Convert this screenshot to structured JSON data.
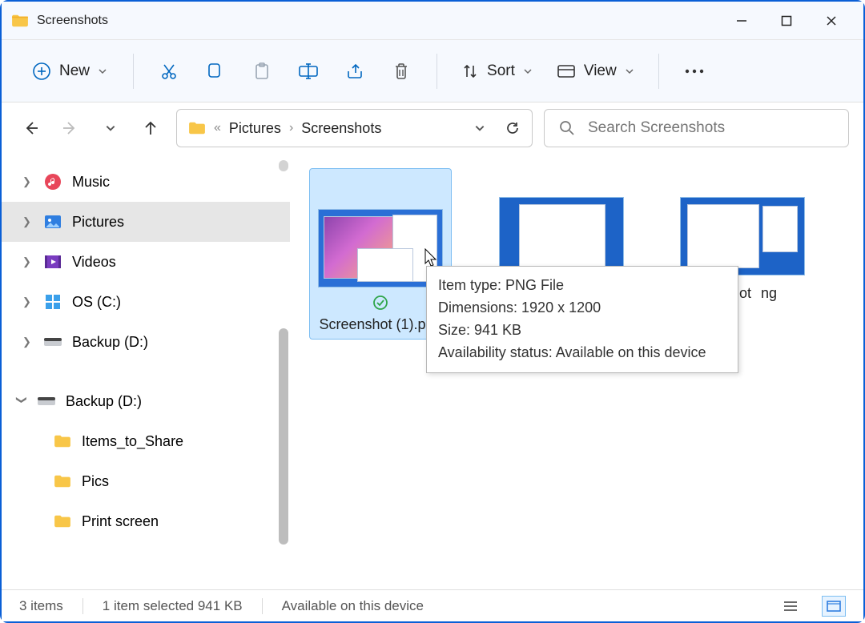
{
  "window": {
    "title": "Screenshots"
  },
  "toolbar": {
    "new_label": "New",
    "sort_label": "Sort",
    "view_label": "View"
  },
  "breadcrumb": {
    "ellipsis": "«",
    "parent": "Pictures",
    "current": "Screenshots"
  },
  "search": {
    "placeholder": "Search Screenshots"
  },
  "sidebar": {
    "items": [
      {
        "label": "Music",
        "icon": "music"
      },
      {
        "label": "Pictures",
        "icon": "pictures",
        "selected": true
      },
      {
        "label": "Videos",
        "icon": "videos"
      },
      {
        "label": "OS (C:)",
        "icon": "drive-os"
      },
      {
        "label": "Backup (D:)",
        "icon": "drive"
      }
    ],
    "group2": {
      "label": "Backup (D:)",
      "children": [
        {
          "label": "Items_to_Share"
        },
        {
          "label": "Pics"
        },
        {
          "label": "Print screen"
        }
      ]
    }
  },
  "files": [
    {
      "name": "Screenshot (1).png",
      "selected": true,
      "sync": true
    },
    {
      "name": ""
    },
    {
      "name_line1": "enshot",
      "name_line2": "ng"
    }
  ],
  "tooltip": {
    "line1": "Item type: PNG File",
    "line2": "Dimensions: 1920 x 1200",
    "line3": "Size: 941 KB",
    "line4": "Availability status: Available on this device"
  },
  "status": {
    "count": "3 items",
    "selected": "1 item selected  941 KB",
    "availability": "Available on this device"
  }
}
